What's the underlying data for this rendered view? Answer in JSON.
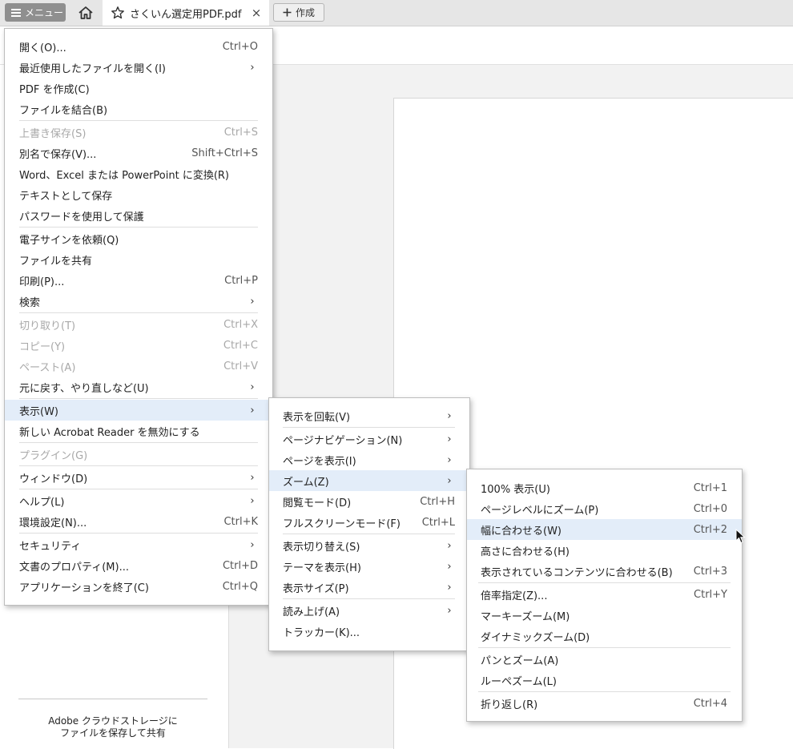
{
  "tabbar": {
    "menu_label": "メニュー",
    "tab_title": "さくいん選定用PDF.pdf",
    "close_glyph": "×",
    "create_label": "作成"
  },
  "promo": {
    "line1": "Adobe クラウドストレージに",
    "line2": "ファイルを保存して共有"
  },
  "main_menu": {
    "items": [
      {
        "label": "開く(O)...",
        "shortcut": "Ctrl+O"
      },
      {
        "label": "最近使用したファイルを開く(I)",
        "shortcut": "›"
      },
      {
        "label": "PDF を作成(C)",
        "shortcut": ""
      },
      {
        "label": "ファイルを結合(B)",
        "shortcut": ""
      },
      {
        "label": "上書き保存(S)",
        "shortcut": "Ctrl+S"
      },
      {
        "label": "別名で保存(V)...",
        "shortcut": "Shift+Ctrl+S"
      },
      {
        "label": "Word、Excel または PowerPoint に変換(R)",
        "shortcut": ""
      },
      {
        "label": "テキストとして保存",
        "shortcut": ""
      },
      {
        "label": "パスワードを使用して保護",
        "shortcut": ""
      },
      {
        "label": "電子サインを依頼(Q)",
        "shortcut": ""
      },
      {
        "label": "ファイルを共有",
        "shortcut": ""
      },
      {
        "label": "印刷(P)...",
        "shortcut": "Ctrl+P"
      },
      {
        "label": "検索",
        "shortcut": "›"
      },
      {
        "label": "切り取り(T)",
        "shortcut": "Ctrl+X"
      },
      {
        "label": "コピー(Y)",
        "shortcut": "Ctrl+C"
      },
      {
        "label": "ペースト(A)",
        "shortcut": "Ctrl+V"
      },
      {
        "label": "元に戻す、やり直しなど(U)",
        "shortcut": "›"
      },
      {
        "label": "表示(W)",
        "shortcut": "›"
      },
      {
        "label": "新しい Acrobat Reader を無効にする",
        "shortcut": ""
      },
      {
        "label": "プラグイン(G)",
        "shortcut": ""
      },
      {
        "label": "ウィンドウ(D)",
        "shortcut": "›"
      },
      {
        "label": "ヘルプ(L)",
        "shortcut": "›"
      },
      {
        "label": "環境設定(N)...",
        "shortcut": "Ctrl+K"
      },
      {
        "label": "セキュリティ",
        "shortcut": "›"
      },
      {
        "label": "文書のプロパティ(M)...",
        "shortcut": "Ctrl+D"
      },
      {
        "label": "アプリケーションを終了(C)",
        "shortcut": "Ctrl+Q"
      }
    ]
  },
  "view_menu": {
    "items": [
      {
        "label": "表示を回転(V)",
        "shortcut": "›"
      },
      {
        "label": "ページナビゲーション(N)",
        "shortcut": "›"
      },
      {
        "label": "ページを表示(I)",
        "shortcut": "›"
      },
      {
        "label": "ズーム(Z)",
        "shortcut": "›"
      },
      {
        "label": "閲覧モード(D)",
        "shortcut": "Ctrl+H"
      },
      {
        "label": "フルスクリーンモード(F)",
        "shortcut": "Ctrl+L"
      },
      {
        "label": "表示切り替え(S)",
        "shortcut": "›"
      },
      {
        "label": "テーマを表示(H)",
        "shortcut": "›"
      },
      {
        "label": "表示サイズ(P)",
        "shortcut": "›"
      },
      {
        "label": "読み上げ(A)",
        "shortcut": "›"
      },
      {
        "label": "トラッカー(K)...",
        "shortcut": ""
      }
    ]
  },
  "zoom_menu": {
    "items": [
      {
        "label": "100% 表示(U)",
        "shortcut": "Ctrl+1"
      },
      {
        "label": "ページレベルにズーム(P)",
        "shortcut": "Ctrl+0"
      },
      {
        "label": "幅に合わせる(W)",
        "shortcut": "Ctrl+2"
      },
      {
        "label": "高さに合わせる(H)",
        "shortcut": ""
      },
      {
        "label": "表示されているコンテンツに合わせる(B)",
        "shortcut": "Ctrl+3"
      },
      {
        "label": "倍率指定(Z)...",
        "shortcut": "Ctrl+Y"
      },
      {
        "label": "マーキーズーム(M)",
        "shortcut": ""
      },
      {
        "label": "ダイナミックズーム(D)",
        "shortcut": ""
      },
      {
        "label": "パンとズーム(A)",
        "shortcut": ""
      },
      {
        "label": "ルーペズーム(L)",
        "shortcut": ""
      },
      {
        "label": "折り返し(R)",
        "shortcut": "Ctrl+4"
      }
    ]
  }
}
